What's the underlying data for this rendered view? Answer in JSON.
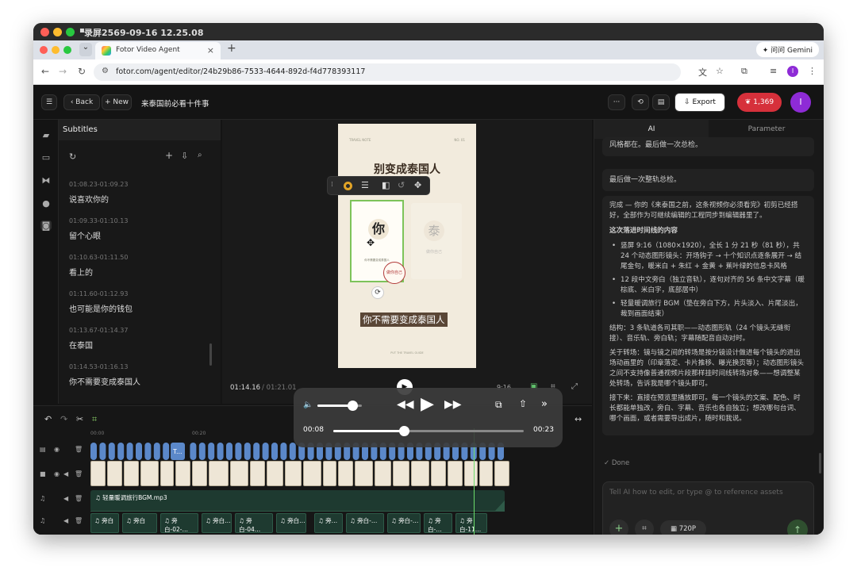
{
  "mac": {
    "title": "录屏2569-09-16 12.25.08"
  },
  "browser": {
    "tab_title": "Fotor Video Agent",
    "tab_close": "×",
    "new_tab": "+",
    "gemini": "✦ 问问 Gemini",
    "url": "fotor.com/agent/editor/24b29b86-7533-4644-892d-f4d778393117",
    "back": "←",
    "forward": "→",
    "reload": "↻",
    "down": "⌄"
  },
  "topbar": {
    "menu": "☰",
    "back": "‹  Back",
    "new": "+  New",
    "project": "来泰国前必看十件事",
    "more": "···",
    "history": "⟲",
    "doc": "▤",
    "export": "⇩  Export",
    "credits": "❦  1,369",
    "avatar": "I"
  },
  "subtitles": {
    "title": "Subtitles",
    "items": [
      {
        "time": "01:08.23-01:09.23",
        "text": "说喜欢你的"
      },
      {
        "time": "01:09.33-01:10.13",
        "text": "留个心眼"
      },
      {
        "time": "01:10.63-01:11.50",
        "text": "看上的"
      },
      {
        "time": "01:11.60-01:12.93",
        "text": "也可能是你的钱包"
      },
      {
        "time": "01:13.67-01:14.37",
        "text": "在泰国"
      },
      {
        "time": "01:14.53-01:16.13",
        "text": "你不需要变成泰国人"
      }
    ]
  },
  "preview": {
    "header_left": "TRAVEL NOTE",
    "header_right": "NO. 01",
    "title": "别变成泰国人",
    "card1_char": "你",
    "card1_sub": "你不需要变成泰国人",
    "card2_char": "泰",
    "card2_sub": "做你自己",
    "stamp": "做你自己",
    "caption": "你不需要变成泰国人",
    "footer": "PUT THE TRAVEL GUIDE",
    "time_current": "01:14.16",
    "time_total": "01:21.01",
    "ratio": "9:16"
  },
  "chat": {
    "tab_ai": "AI",
    "tab_param": "Parameter",
    "m1": "风格都在。最后做一次总检。",
    "m2": "最后做一次整轨总检。",
    "m3_intro": "完成 — 你的《来泰国之前，这条视频你必须看完》初剪已经搭好，全部作为可继续编辑的工程同步到编辑器里了。",
    "m3_heading": "这次落进时间线的内容",
    "b1": "竖屏 9:16（1080×1920），全长 1 分 21 秒（81 秒），共 24 个动态图形镜头：开场钩子 → 十个知识点逐条展开 → 结尾金句，暖米白 + 朱红 + 金黄 + 蕉叶绿的信息卡风格",
    "b2": "12 段中文旁白（独立音轨），逐句对齐的 56 条中文字幕（暖棕底、米白字，底部居中）",
    "b3": "轻量暖调旅行 BGM（垫在旁白下方，片头淡入、片尾淡出，裁到画面结束）",
    "p1": "结构：3 条轨道各司其职——动态图形轨（24 个镜头无缝衔接）、音乐轨、旁白轨；字幕随配音自动对时。",
    "p2": "关于转场：镜与镜之间的转场是按分镜设计做进每个镜头的进出场动画里的（印章落定、卡片推移、曝光换页等）；动态图形镜头之间不支持像普通视频片段那样挂时间线转场对象——想调整某处转场，告诉我是哪个镜头即可。",
    "p3": "接下来：直接在预览里播放即可。每一个镜头的文案、配色、时长都能单独改，旁白、字幕、音乐也各自独立；想改哪句台词、哪个画面，或者需要导出成片，随时和我说。",
    "done": "✓  Done",
    "placeholder": "Tell AI how to edit, or type @ to reference assets",
    "res": "720P"
  },
  "timeline": {
    "bgm": "♫ 轻量暖调旅行BGM.mp3",
    "tick0": "00:00",
    "tick1": "00:20",
    "vo": [
      "♫ 旁白",
      "♫ 旁白",
      "♫ 旁白-02-…",
      "♫ 旁白…",
      "♫ 旁白-04…",
      "♫ 旁白…",
      "♫ 旁…",
      "♫ 旁白-…",
      "♫ 旁白-…",
      "♫ 旁白-…",
      "♫ 旁白-11…"
    ]
  },
  "player": {
    "cur": "00:08",
    "total": "00:23",
    "progress": 0.37,
    "volume": 0.78
  }
}
